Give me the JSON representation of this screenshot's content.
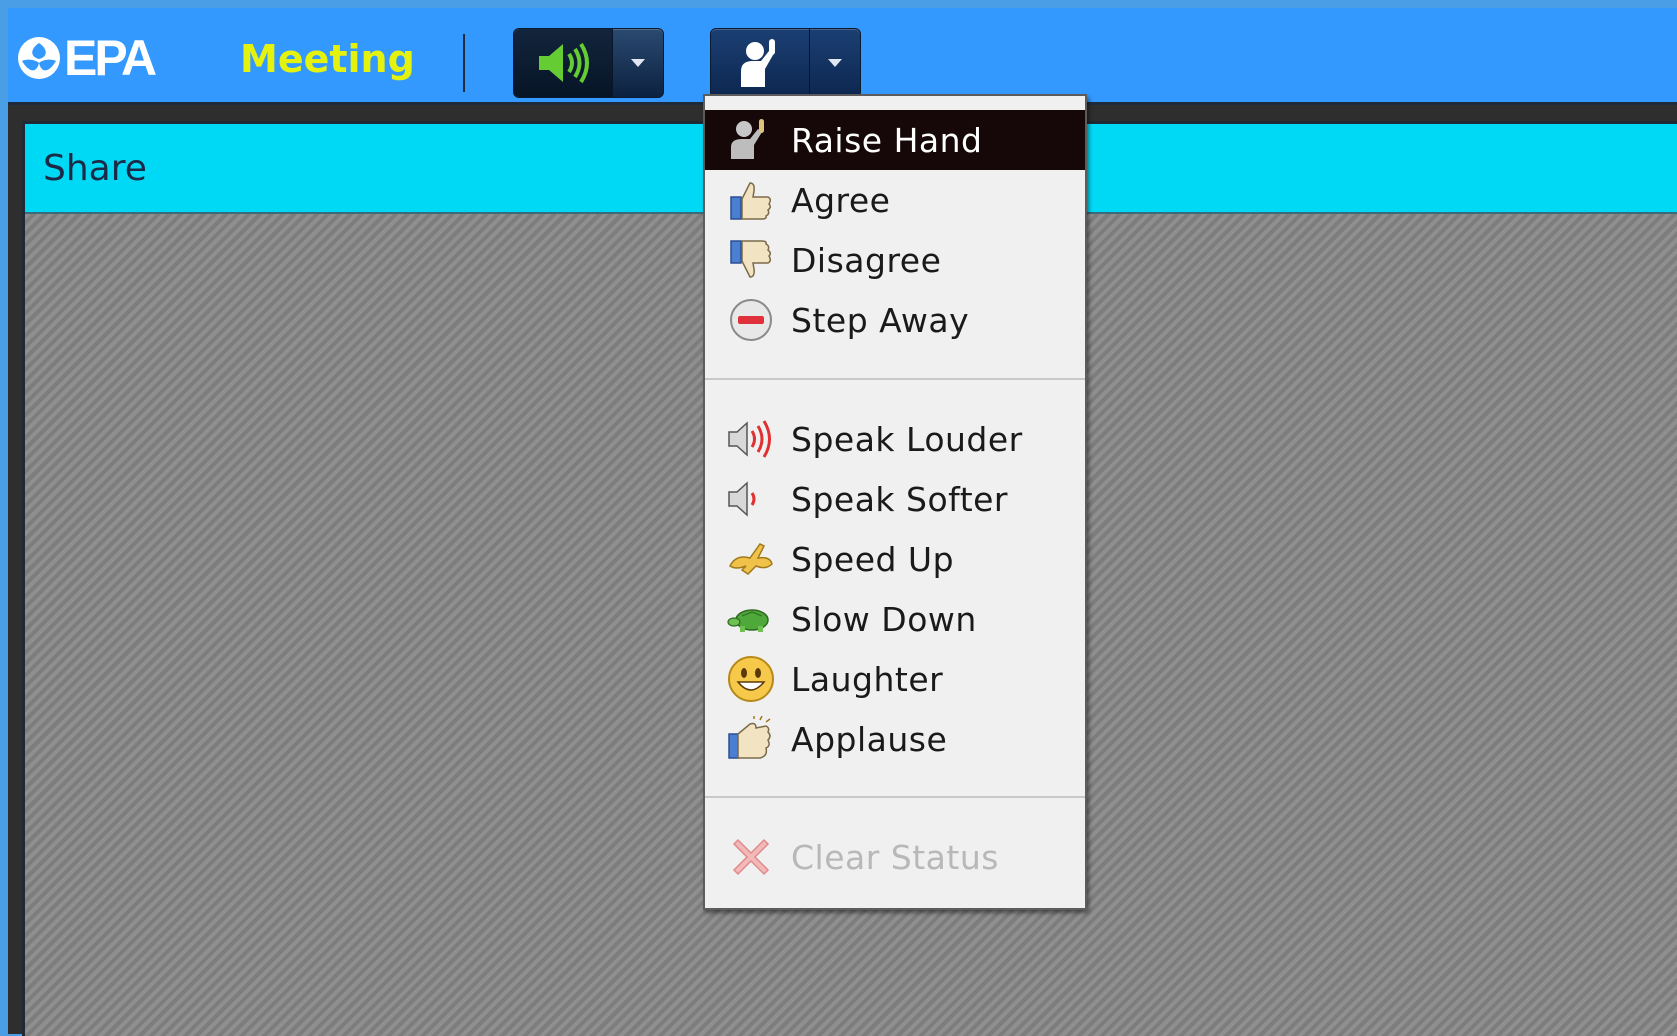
{
  "header": {
    "logo_text": "EPA",
    "meeting_label": "Meeting",
    "audio_button": {
      "icon": "speaker-icon",
      "color": "#66cc33"
    },
    "status_button": {
      "icon": "raised-hand-icon"
    }
  },
  "share_panel": {
    "title": "Share",
    "header_color": "#00d9f5"
  },
  "status_menu": {
    "groups": [
      [
        {
          "label": "Raise Hand",
          "icon": "raise-hand-icon",
          "state": "selected"
        },
        {
          "label": "Agree",
          "icon": "thumbs-up-icon"
        },
        {
          "label": "Disagree",
          "icon": "thumbs-down-icon"
        },
        {
          "label": "Step Away",
          "icon": "step-away-icon"
        }
      ],
      [
        {
          "label": "Speak Louder",
          "icon": "speaker-loud-icon"
        },
        {
          "label": "Speak Softer",
          "icon": "speaker-soft-icon"
        },
        {
          "label": "Speed Up",
          "icon": "rabbit-icon"
        },
        {
          "label": "Slow Down",
          "icon": "turtle-icon"
        },
        {
          "label": "Laughter",
          "icon": "smiley-icon"
        },
        {
          "label": "Applause",
          "icon": "clapping-hands-icon"
        }
      ],
      [
        {
          "label": "Clear Status",
          "icon": "clear-x-icon",
          "state": "disabled"
        }
      ]
    ]
  },
  "colors": {
    "topbar": "#3399ff",
    "meeting_label": "#e4f20e",
    "menu_selected_bg": "#160808"
  }
}
